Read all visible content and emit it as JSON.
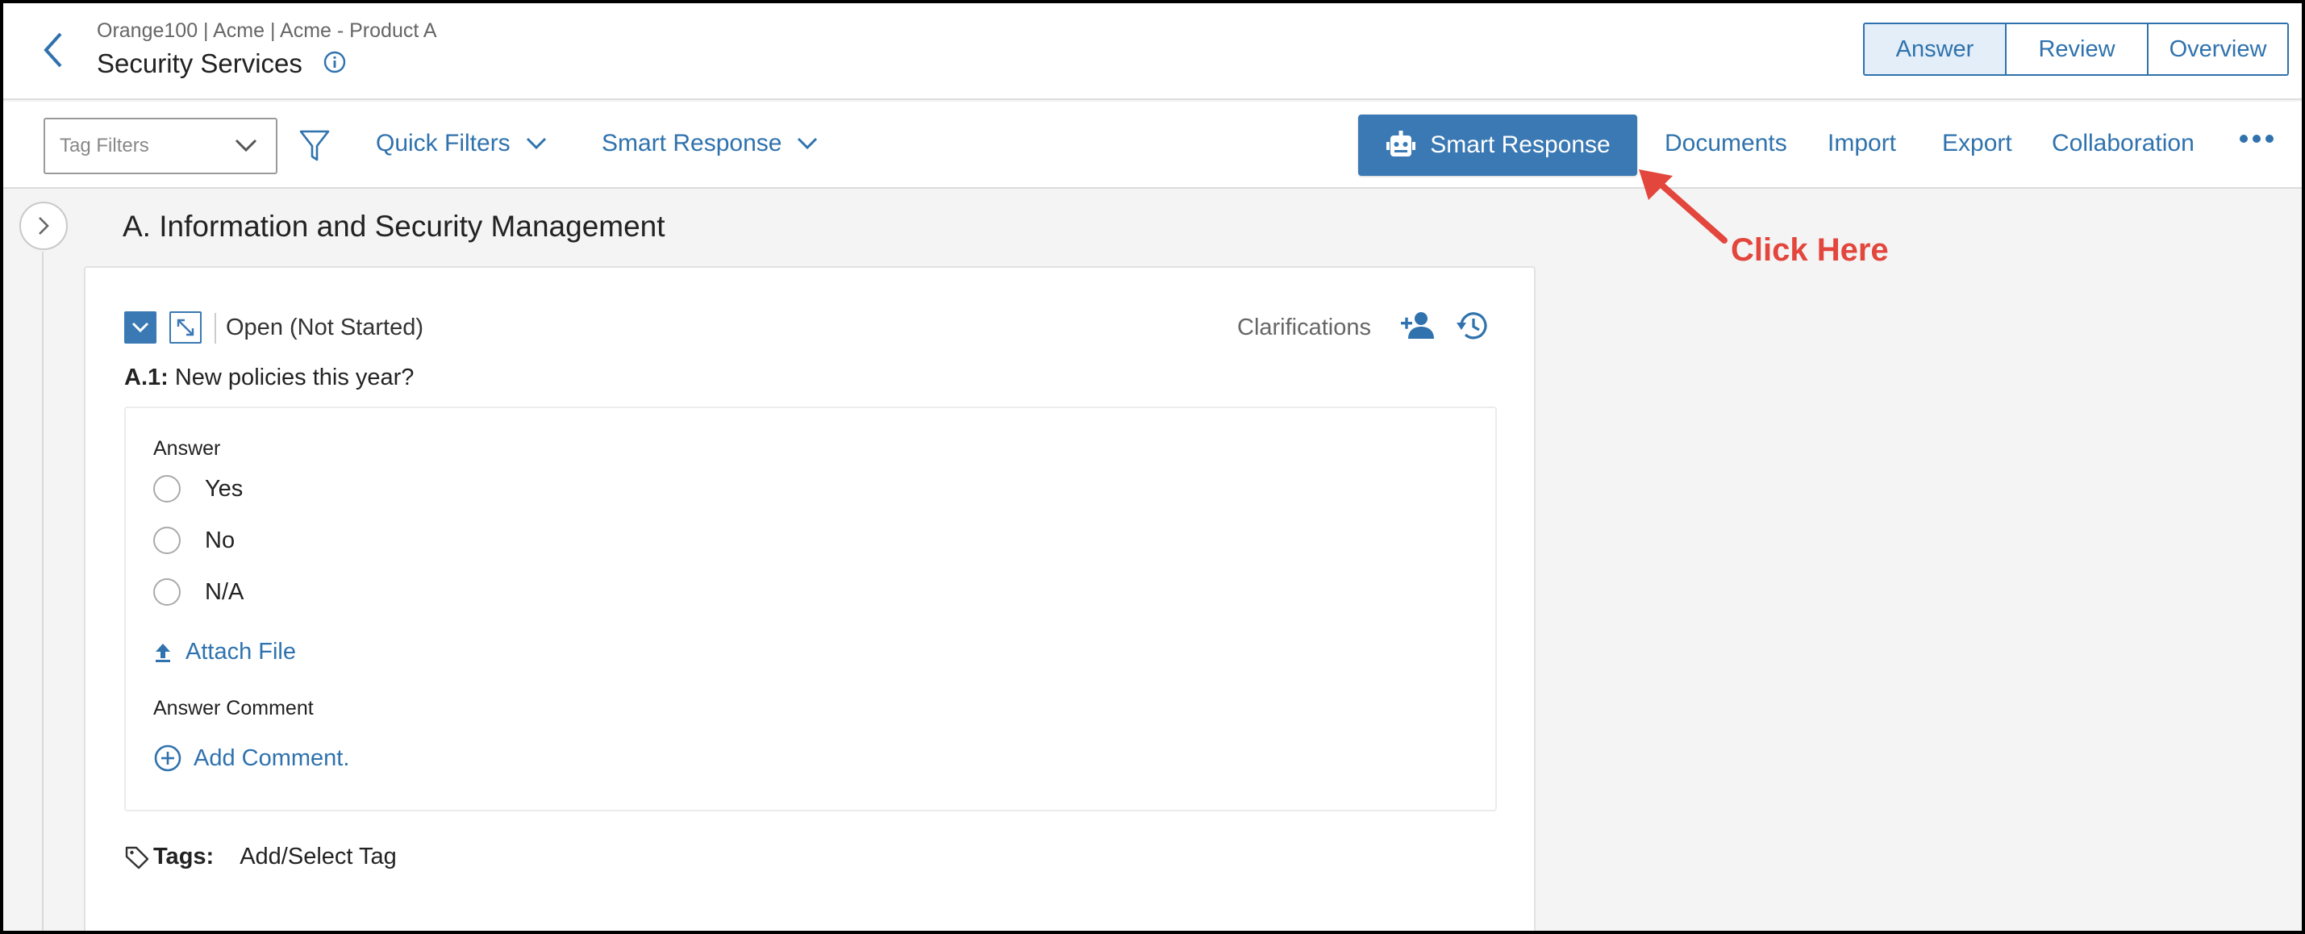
{
  "header": {
    "breadcrumb": "Orange100 | Acme | Acme - Product A",
    "title": "Security Services",
    "view_tabs": [
      {
        "label": "Answer",
        "active": true
      },
      {
        "label": "Review",
        "active": false
      },
      {
        "label": "Overview",
        "active": false
      }
    ]
  },
  "toolbar": {
    "tag_filter_placeholder": "Tag Filters",
    "quick_filters": "Quick Filters",
    "smart_response_dropdown": "Smart Response",
    "smart_response_button": "Smart Response",
    "links": [
      "Documents",
      "Import",
      "Export",
      "Collaboration"
    ]
  },
  "section": {
    "title": "A. Information and Security Management"
  },
  "question": {
    "status": "Open (Not Started)",
    "clarifications": "Clarifications",
    "id": "A.1:",
    "text": "New policies this year?",
    "answer_label": "Answer",
    "options": [
      "Yes",
      "No",
      "N/A"
    ],
    "attach_file": "Attach File",
    "comment_label": "Answer Comment",
    "add_comment": "Add Comment.",
    "tags_label": "Tags:",
    "tags_value": "Add/Select Tag"
  },
  "annotation": {
    "text": "Click Here"
  },
  "colors": {
    "brand_blue": "#3a79b3",
    "link_blue": "#2f72ad",
    "annotation_red": "#e2463c"
  }
}
